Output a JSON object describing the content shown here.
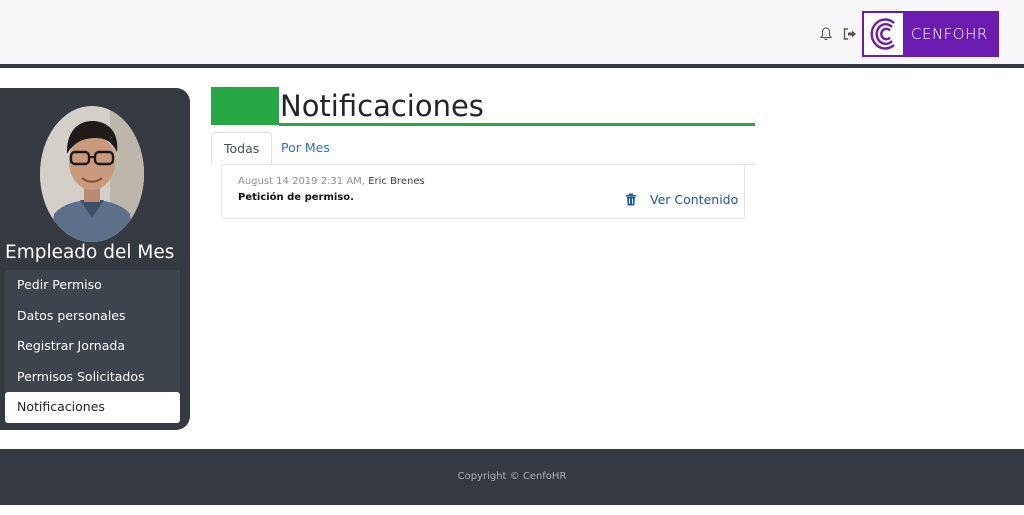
{
  "header": {
    "brand_name": "CENFOHR",
    "icons": [
      "bell-icon",
      "logout-icon"
    ],
    "brand_color": "#6a1bb0"
  },
  "sidebar": {
    "title": "Empleado del Mes",
    "items": [
      {
        "label": "Pedir Permiso",
        "active": false
      },
      {
        "label": "Datos personales",
        "active": false
      },
      {
        "label": "Registrar Jornada",
        "active": false
      },
      {
        "label": "Permisos Solicitados",
        "active": false
      },
      {
        "label": "Notificaciones",
        "active": true
      }
    ]
  },
  "main": {
    "title": "Notificaciones",
    "accent_color": "#28a745",
    "tabs": [
      {
        "label": "Todas",
        "active": true
      },
      {
        "label": "Por Mes",
        "active": false
      }
    ],
    "notifications": [
      {
        "date": "August 14 2019 2:31 AM,",
        "author": "Eric Brenes",
        "message": "Petición de permiso.",
        "action_label": "Ver Contenido",
        "action_icon": "trash-icon"
      }
    ]
  },
  "footer": {
    "copyright": "Copyright © CenfoHR"
  }
}
